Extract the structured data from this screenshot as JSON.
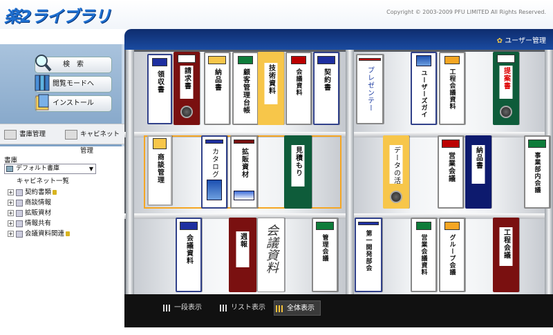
{
  "header": {
    "logo": "楽2ライブラリ",
    "copyright": "Copyright © 2003-2009 PFU LIMITED All Rights Reserved.",
    "user_admin": "ユーザー管理"
  },
  "sidebar": {
    "buttons": {
      "search": "検　索",
      "browse_mode": "閲覧モードへ",
      "install": "インストール"
    },
    "tabs": {
      "library_mgmt": "書庫管理",
      "cabinet_mgmt": "キャビネット管理"
    },
    "library_label": "書庫",
    "cabinet_select": "デフォルト書庫",
    "tree": {
      "root": "キャビネット一覧",
      "items": [
        "契約書類",
        "商談情報",
        "拡販資材",
        "情報共有",
        "会議資料関連"
      ]
    }
  },
  "views": {
    "single": "一段表示",
    "list": "リスト表示",
    "all": "全体表示",
    "selected": "全体表示"
  },
  "binders": {
    "row1": [
      "領収書",
      "請求書",
      "納品書",
      "顧客管理台帳",
      "技術資料",
      "会議資料",
      "契約書",
      "プレゼンテー",
      "ユーザーズガイ",
      "工程会議資料",
      "提案書"
    ],
    "row2": [
      "商談管理",
      "カタログ",
      "拡販資材",
      "見積もり",
      "データの活",
      "営業会議",
      "納品書",
      "事業部内会議"
    ],
    "row3": [
      "会議資料",
      "週報",
      "会議資料",
      "管理会議",
      "第一開発部会",
      "営業会議資料",
      "グループ会議",
      "工程会議"
    ]
  },
  "colors": {
    "header_blue": "#1a4ba0",
    "selection": "#f5a623",
    "maroon": "#7a1010",
    "green": "#0e5c3a",
    "navy": "#0d1a6e",
    "yellow": "#f7c64a"
  }
}
